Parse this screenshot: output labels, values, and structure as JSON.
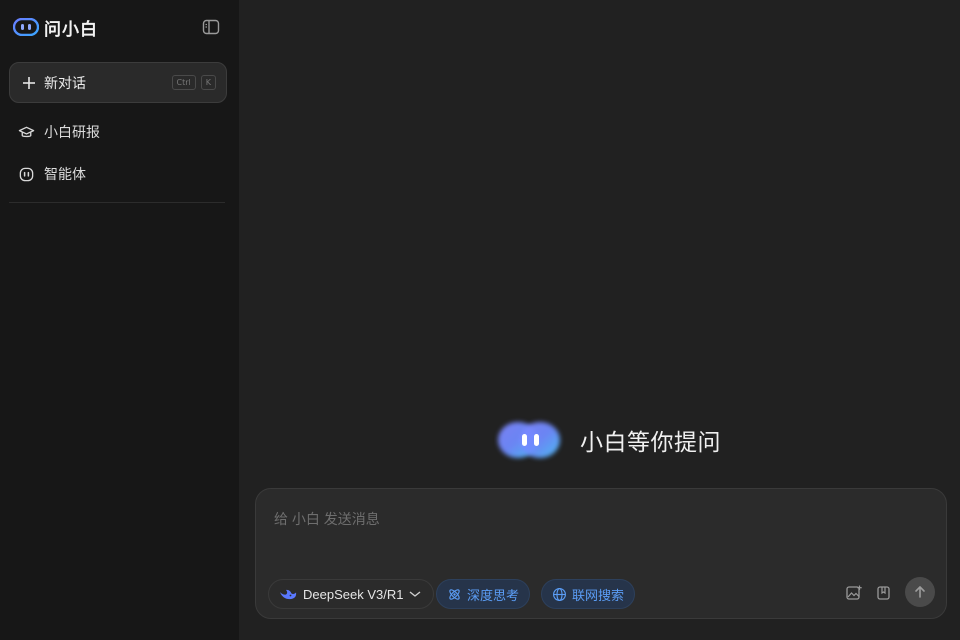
{
  "app": {
    "logo_text": "问小白",
    "brand_color": "#4f6cf5"
  },
  "sidebar": {
    "new_chat": {
      "label": "新对话",
      "shortcut": [
        "Ctrl",
        "K"
      ]
    },
    "items": [
      {
        "label": "小白研报",
        "icon": "graduation-cap-icon"
      },
      {
        "label": "智能体",
        "icon": "robot-face-icon"
      }
    ]
  },
  "main": {
    "welcome_text": "小白等你提问"
  },
  "composer": {
    "placeholder": "给 小白 发送消息",
    "model": {
      "label": "DeepSeek V3/R1",
      "icon": "deepseek-whale-icon"
    },
    "toggles": [
      {
        "label": "深度思考",
        "icon": "atom-icon",
        "active": true
      },
      {
        "label": "联网搜索",
        "icon": "globe-icon",
        "active": true
      }
    ],
    "accent_color": "#5b9df5"
  }
}
